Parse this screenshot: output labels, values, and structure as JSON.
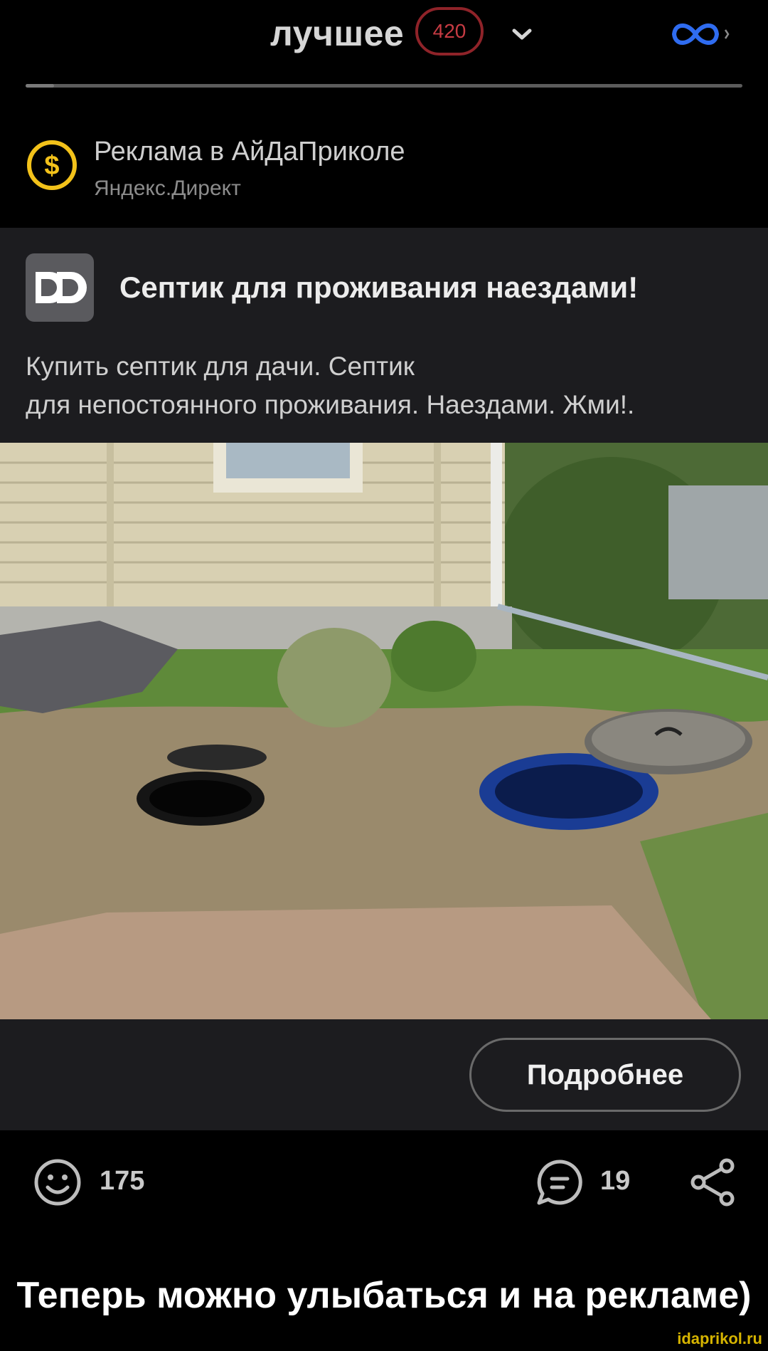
{
  "header": {
    "feed_title": "лучшее",
    "count_badge": "420",
    "feed_progress": 0.04
  },
  "ad_header": {
    "label": "Реклама в АйДаПриколе",
    "source": "Яндекс.Директ"
  },
  "ad": {
    "headline": "Септик для проживания наездами!",
    "description": "Купить септик для дачи. Септик\nдля непостоянного проживания. Наездами. Жми!.",
    "button_label": "Подробнее"
  },
  "actions": {
    "like_count": "175",
    "comment_count": "19"
  },
  "caption": "Теперь можно улыбаться и на рекламе)",
  "watermark": "idaprikol.ru",
  "colors": {
    "badge_border": "#8f2329",
    "infinity_blue": "#2f6cf0",
    "dollar_yellow": "#f3c21a"
  }
}
